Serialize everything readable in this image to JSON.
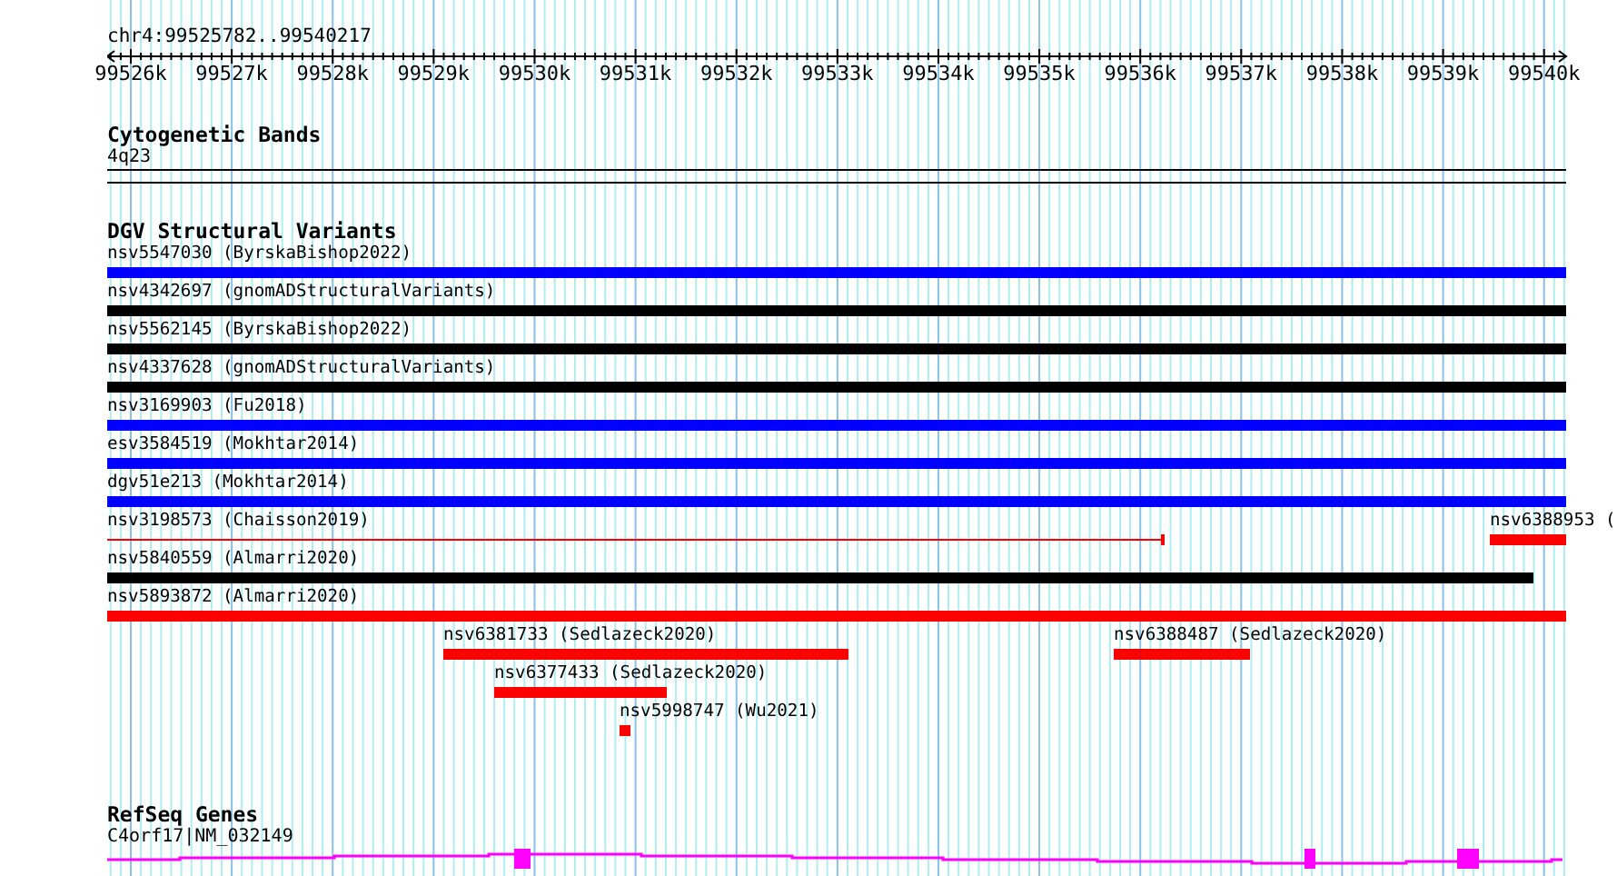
{
  "position": "chr4:99525782..99540217",
  "ruler": {
    "ticks": [
      "99526k",
      "99527k",
      "99528k",
      "99529k",
      "99530k",
      "99531k",
      "99532k",
      "99533k",
      "99534k",
      "99535k",
      "99536k",
      "99537k",
      "99538k",
      "99539k",
      "99540k"
    ]
  },
  "cytogenetic_bands": {
    "title": "Cytogenetic Bands",
    "band": "4q23"
  },
  "dgv_structural_variants": {
    "title": "DGV Structural Variants",
    "rows": [
      {
        "items": [
          {
            "label": "nsv5547030 (ByrskaBishop2022)",
            "color": "#0000ff",
            "kind": "bar"
          }
        ]
      },
      {
        "items": [
          {
            "label": "nsv4342697 (gnomADStructuralVariants)",
            "color": "#000000",
            "kind": "bar"
          }
        ]
      },
      {
        "items": [
          {
            "label": "nsv5562145 (ByrskaBishop2022)",
            "color": "#000000",
            "kind": "bar"
          }
        ]
      },
      {
        "items": [
          {
            "label": "nsv4337628 (gnomADStructuralVariants)",
            "color": "#000000",
            "kind": "bar"
          }
        ]
      },
      {
        "items": [
          {
            "label": "nsv3169903 (Fu2018)",
            "color": "#0000ff",
            "kind": "bar"
          }
        ]
      },
      {
        "items": [
          {
            "label": "esv3584519 (Mokhtar2014)",
            "color": "#0000ff",
            "kind": "bar"
          }
        ]
      },
      {
        "items": [
          {
            "label": "dgv51e213 (Mokhtar2014)",
            "color": "#0000ff",
            "kind": "bar"
          }
        ]
      },
      {
        "items": [
          {
            "label": "nsv3198573 (Chaisson2019)",
            "color": "#ff0000",
            "kind": "line"
          },
          {
            "label": "nsv6388953 (",
            "color": "#ff0000",
            "kind": "bar"
          }
        ]
      },
      {
        "items": [
          {
            "label": "nsv5840559 (Almarri2020)",
            "color": "#000000",
            "kind": "bar"
          }
        ]
      },
      {
        "items": [
          {
            "label": "nsv5893872 (Almarri2020)",
            "color": "#ff0000",
            "kind": "bar"
          }
        ]
      },
      {
        "items": [
          {
            "label": "nsv6381733 (Sedlazeck2020)",
            "color": "#ff0000",
            "kind": "bar"
          },
          {
            "label": "nsv6388487 (Sedlazeck2020)",
            "color": "#ff0000",
            "kind": "bar"
          }
        ]
      },
      {
        "items": [
          {
            "label": "nsv6377433 (Sedlazeck2020)",
            "color": "#ff0000",
            "kind": "bar"
          }
        ]
      },
      {
        "items": [
          {
            "label": "nsv5998747 (Wu2021)",
            "color": "#ff0000",
            "kind": "bar"
          }
        ]
      }
    ]
  },
  "refseq_genes": {
    "title": "RefSeq Genes",
    "gene": "C4orf17|NM_032149"
  }
}
